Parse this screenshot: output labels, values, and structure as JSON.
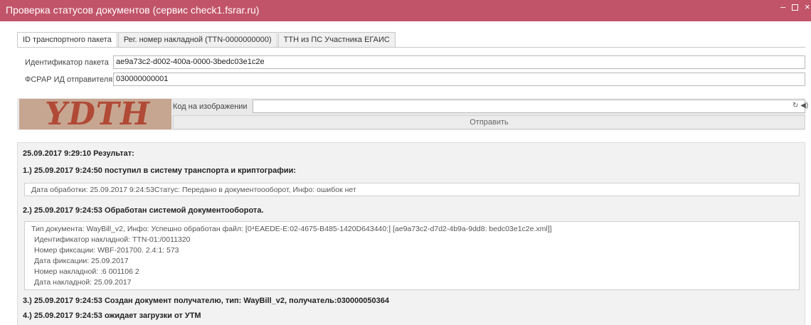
{
  "window": {
    "title": "Проверка статусов документов (сервис check1.fsrar.ru)",
    "minimize": "–",
    "close": "×"
  },
  "tabs": [
    {
      "label": "ID транспортного пакета",
      "active": true
    },
    {
      "label": "Рег. номер накладной (TTN-0000000000)",
      "active": false
    },
    {
      "label": "ТТН из ПС Участника ЕГАИС",
      "active": false
    }
  ],
  "form": {
    "package_id_label": "Идентификатор пакета",
    "package_id_value": "ae9a73c2-d002-400a-0000-3bedc03e1c2e",
    "sender_label": "ФСРАР ИД отправителя",
    "sender_value": "030000000001"
  },
  "captcha": {
    "image_text": "YDTH",
    "code_label": "Код на изображении",
    "code_value": "",
    "icons": "↻ ◀)",
    "submit_label": "Отправить"
  },
  "results": {
    "header": "25.09.2017 9:29:10 Результат:",
    "step1": "1.) 25.09.2017 9:24:50 поступил в систему транспорта и криптографии:",
    "step1_info": "Дата обработки: 25.09.2017 9:24:53Статус: Передано в документоооборот, Инфо: ошибок нет",
    "step2": "2.) 25.09.2017 9:24:53 Обработан системой документооборота.",
    "step2_lines": [
      "Тип документа: WayBill_v2, Инфо: Успешно обработан файл: [0⁴EAEDE-E:02-4675-B485-1420D643440:] [ae9a73c2-d7d2-4b9a-9dd8: bedc03e1c2e.xml]]",
      "Идентификатор накладной: TTN-01:/0011320",
      "Номер фиксации: WBF-201700. 2.4:1: 573",
      "Дата фиксации: 25.09.2017",
      "Номер накладной: :6 001106 2",
      "Дата накладной: 25.09.2017"
    ],
    "step3": "3.) 25.09.2017 9:24:53 Создан документ получателю, тип: WayBill_v2, получатель:030000050364",
    "step4": "4.) 25.09.2017 9:24:53 ожидает загрузки от УТМ"
  }
}
